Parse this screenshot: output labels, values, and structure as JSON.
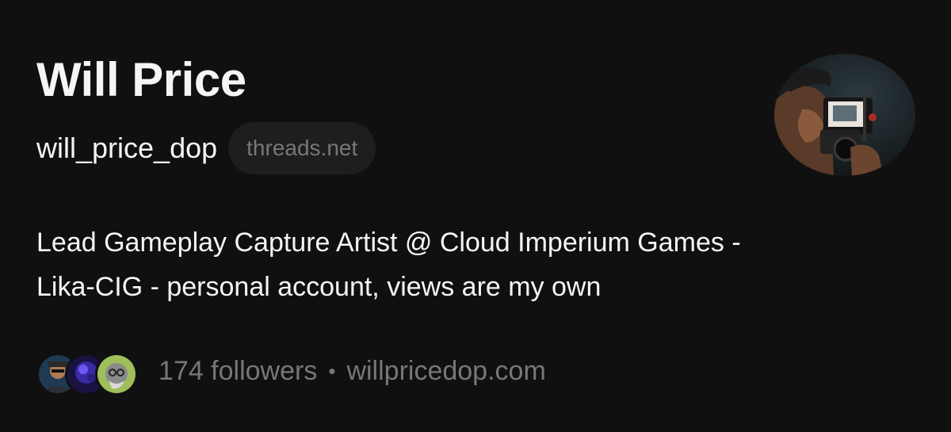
{
  "profile": {
    "display_name": "Will Price",
    "username": "will_price_dop",
    "domain_badge": "threads.net",
    "bio_lines": [
      "Lead Gameplay Capture Artist @ Cloud Imperium Games -",
      "Lika-CIG - personal account, views are my own"
    ],
    "followers_text": "174 followers",
    "separator": "•",
    "website": "willpricedop.com",
    "avatar_icon": "profile-photo-camera-operator",
    "follower_avatars": [
      "follower-avatar-1",
      "follower-avatar-2",
      "follower-avatar-3"
    ]
  },
  "colors": {
    "background": "#101010",
    "primary_text": "#f3f5f7",
    "secondary_text": "#777777",
    "pill_background": "#1e1e1e"
  }
}
